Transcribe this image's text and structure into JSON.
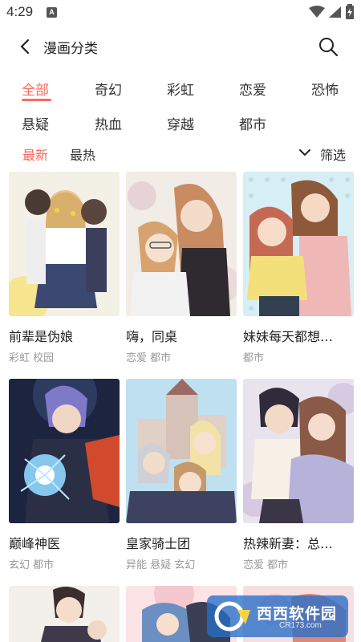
{
  "status": {
    "time": "4:29",
    "notif_letter": "A"
  },
  "header": {
    "title": "漫画分类"
  },
  "categories": [
    {
      "label": "全部",
      "active": true
    },
    {
      "label": "奇幻",
      "active": false
    },
    {
      "label": "彩虹",
      "active": false
    },
    {
      "label": "恋爱",
      "active": false
    },
    {
      "label": "恐怖",
      "active": false
    },
    {
      "label": "悬疑",
      "active": false
    },
    {
      "label": "热血",
      "active": false
    },
    {
      "label": "穿越",
      "active": false
    },
    {
      "label": "都市",
      "active": false
    }
  ],
  "sort": {
    "latest": "最新",
    "hottest": "最热",
    "filter": "筛选"
  },
  "comics": [
    {
      "title": "前辈是伪娘",
      "tags": "彩虹 校园"
    },
    {
      "title": "嗨，同桌",
      "tags": "恋爱 都市"
    },
    {
      "title": "妹妹每天都想…",
      "tags": "都市"
    },
    {
      "title": "巅峰神医",
      "tags": "玄幻 都市"
    },
    {
      "title": "皇家骑士团",
      "tags": "异能 悬疑 玄幻"
    },
    {
      "title": "热辣新妻：总…",
      "tags": "恋爱 都市"
    }
  ],
  "watermark": {
    "brand": "西西软件园",
    "url": "CR173.com"
  },
  "colors": {
    "accent": "#ff6a5c",
    "text": "#222222",
    "muted": "#999999"
  }
}
